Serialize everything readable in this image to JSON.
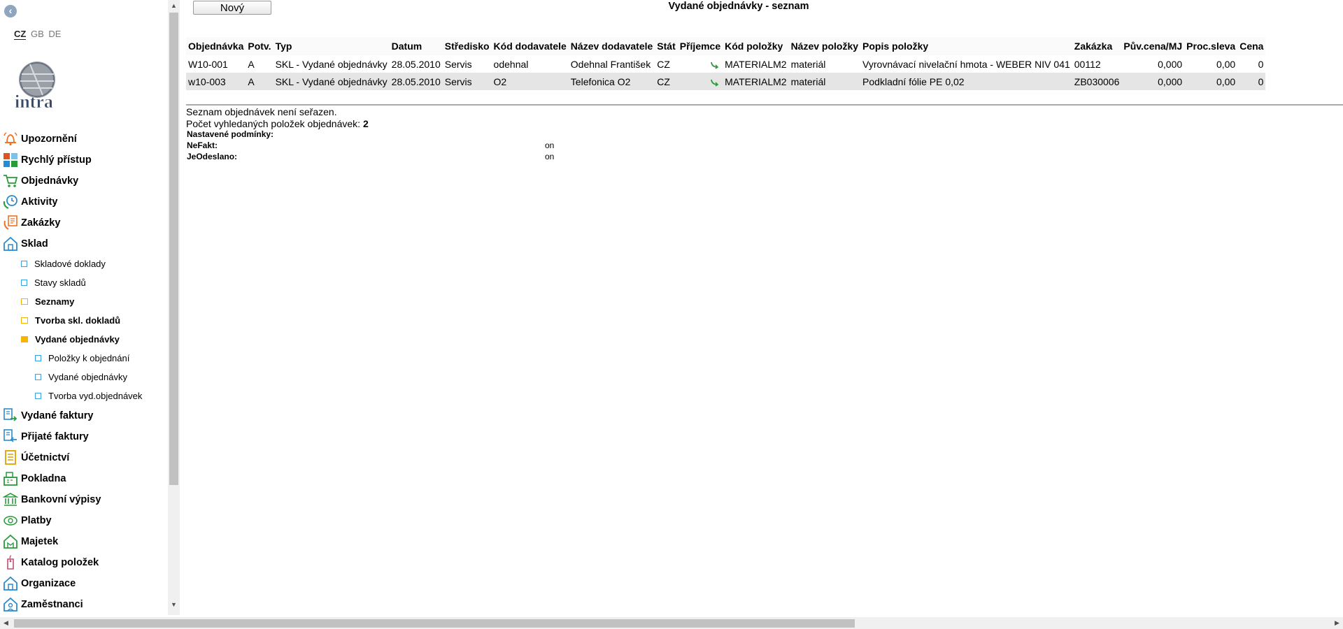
{
  "languages": [
    "CZ",
    "GB",
    "DE"
  ],
  "logo_text": "intra",
  "menu": [
    {
      "label": "Upozornění",
      "icon": "bell-icon",
      "color": "#f07020"
    },
    {
      "label": "Rychlý přístup",
      "icon": "tiles-icon",
      "color": "#e05020"
    },
    {
      "label": "Objednávky",
      "icon": "cart-icon",
      "color": "#2a9a3a"
    },
    {
      "label": "Aktivity",
      "icon": "clock-phone-icon",
      "color": "#2a8ad0"
    },
    {
      "label": "Zakázky",
      "icon": "clipboard-phone-icon",
      "color": "#f07020"
    },
    {
      "label": "Sklad",
      "icon": "warehouse-icon",
      "color": "#2a8ad0"
    }
  ],
  "sklad_sub": [
    {
      "label": "Skladové doklady",
      "type": "square",
      "bold": false,
      "level": 1
    },
    {
      "label": "Stavy skladů",
      "type": "square",
      "bold": false,
      "level": 1
    },
    {
      "label": "Seznamy",
      "type": "folder",
      "bold": true,
      "level": 1
    },
    {
      "label": "Tvorba skl. dokladů",
      "type": "folder",
      "bold": true,
      "level": 1
    },
    {
      "label": "Vydané objednávky",
      "type": "folder-open",
      "bold": true,
      "level": 1
    },
    {
      "label": "Položky k objednání",
      "type": "square",
      "bold": false,
      "level": 2
    },
    {
      "label": "Vydané objednávky",
      "type": "square",
      "bold": false,
      "level": 2
    },
    {
      "label": "Tvorba vyd.objednávek",
      "type": "square",
      "bold": false,
      "level": 2
    }
  ],
  "menu2": [
    {
      "label": "Vydané faktury",
      "icon": "invoice-out-icon",
      "color": "#2a8ad0"
    },
    {
      "label": "Přijaté faktury",
      "icon": "invoice-in-icon",
      "color": "#2a8ad0"
    },
    {
      "label": "Účetnictví",
      "icon": "ledger-icon",
      "color": "#e0a000"
    },
    {
      "label": "Pokladna",
      "icon": "cash-register-icon",
      "color": "#2a9a3a"
    },
    {
      "label": "Bankovní výpisy",
      "icon": "bank-icon",
      "color": "#2a9a3a"
    },
    {
      "label": "Platby",
      "icon": "payment-icon",
      "color": "#2a9a3a"
    },
    {
      "label": "Majetek",
      "icon": "property-icon",
      "color": "#2a9a3a"
    },
    {
      "label": "Katalog položek",
      "icon": "tag-icon",
      "color": "#c05070"
    },
    {
      "label": "Organizace",
      "icon": "building-icon",
      "color": "#2a8ad0"
    },
    {
      "label": "Zaměstnanci",
      "icon": "people-icon",
      "color": "#2a8ad0"
    }
  ],
  "toolbar": {
    "new_label": "Nový"
  },
  "page_title": "Vydané objednávky - seznam",
  "table": {
    "headers": [
      "Objednávka",
      "Potv.",
      "Typ",
      "Datum",
      "Středisko",
      "Kód dodavatele",
      "Název dodavatele",
      "Stát",
      "Příjemce",
      "Kód položky",
      "Název položky",
      "Popis položky",
      "Zakázka",
      "Pův.cena/MJ",
      "Proc.sleva",
      "Cena"
    ],
    "rows": [
      [
        "W10-001",
        "A",
        "SKL - Vydané objednávky",
        "28.05.2010",
        "Servis",
        "odehnal",
        "Odehnal František",
        "CZ",
        "",
        "MATERIALM2",
        "materiál",
        "Vyrovnávací nivelační hmota - WEBER NIV 041",
        "00112",
        "0,000",
        "0,00",
        "0"
      ],
      [
        "w10-003",
        "A",
        "SKL - Vydané objednávky",
        "28.05.2010",
        "Servis",
        "O2",
        "Telefonica O2",
        "CZ",
        "",
        "MATERIALM2",
        "materiál",
        "Podkladní fólie PE 0,02",
        "ZB030006",
        "0,000",
        "0,00",
        "0"
      ]
    ]
  },
  "info": {
    "unsorted": "Seznam objednávek není seřazen.",
    "count_label": "Počet vyhledaných položek objednávek:",
    "count_value": "2",
    "conditions_title": "Nastavené podmínky:",
    "conditions": [
      {
        "name": "NeFakt:",
        "value": "on"
      },
      {
        "name": "JeOdeslano:",
        "value": "on"
      }
    ]
  }
}
